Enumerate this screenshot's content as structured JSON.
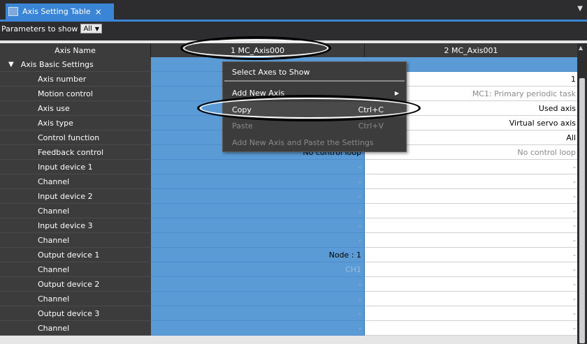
{
  "tab": {
    "title": "Axis Setting Table",
    "close": "×",
    "menu": "▼"
  },
  "params": {
    "label": "Parameters to show",
    "value": "All",
    "arrow": "▼"
  },
  "header": {
    "name_col": "Axis Name",
    "axis1": "1 MC_Axis000",
    "axis2": "2 MC_Axis001"
  },
  "section": {
    "label": "Axis Basic Settings",
    "toggle": "▼"
  },
  "rows": [
    {
      "name": "Axis number",
      "v1": "",
      "v2": "1"
    },
    {
      "name": "Motion control",
      "v1": "",
      "v2": "MC1: Primary periodic task"
    },
    {
      "name": "Axis use",
      "v1": "",
      "v2": "Used axis"
    },
    {
      "name": "Axis type",
      "v1": "",
      "v2": "Virtual servo axis"
    },
    {
      "name": "Control function",
      "v1": "",
      "v2": "All"
    },
    {
      "name": "Feedback control",
      "v1": "No control loop",
      "v2": "No control loop"
    },
    {
      "name": "Input device 1",
      "v1": "-",
      "v2": "-"
    },
    {
      "name": "Channel",
      "v1": "-",
      "v2": "-"
    },
    {
      "name": "Input device 2",
      "v1": "-",
      "v2": "-"
    },
    {
      "name": "Channel",
      "v1": "-",
      "v2": "-"
    },
    {
      "name": "Input device 3",
      "v1": "-",
      "v2": "-"
    },
    {
      "name": "Channel",
      "v1": "-",
      "v2": "-"
    },
    {
      "name": "Output device 1",
      "v1": "Node : 1",
      "v2": "-"
    },
    {
      "name": "Channel",
      "v1": "CH1",
      "v2": "-"
    },
    {
      "name": "Output device 2",
      "v1": "-",
      "v2": "-"
    },
    {
      "name": "Channel",
      "v1": "-",
      "v2": "-"
    },
    {
      "name": "Output device 3",
      "v1": "-",
      "v2": "-"
    },
    {
      "name": "Channel",
      "v1": "-",
      "v2": "-"
    }
  ],
  "menu": {
    "items": [
      {
        "label": "Select Axes to Show",
        "shortcut": ""
      },
      {
        "label": "Add New Axis",
        "shortcut": ""
      },
      {
        "label": "Copy",
        "shortcut": "Ctrl+C"
      },
      {
        "label": "Paste",
        "shortcut": "Ctrl+V"
      },
      {
        "label": "Add New Axis and Paste the Settings",
        "shortcut": ""
      }
    ],
    "submenu_arrow": "▶"
  },
  "colors": {
    "accent": "#3a85d6",
    "selected_column": "#5b9bd5",
    "panel_dark": "#3c3c3c"
  }
}
